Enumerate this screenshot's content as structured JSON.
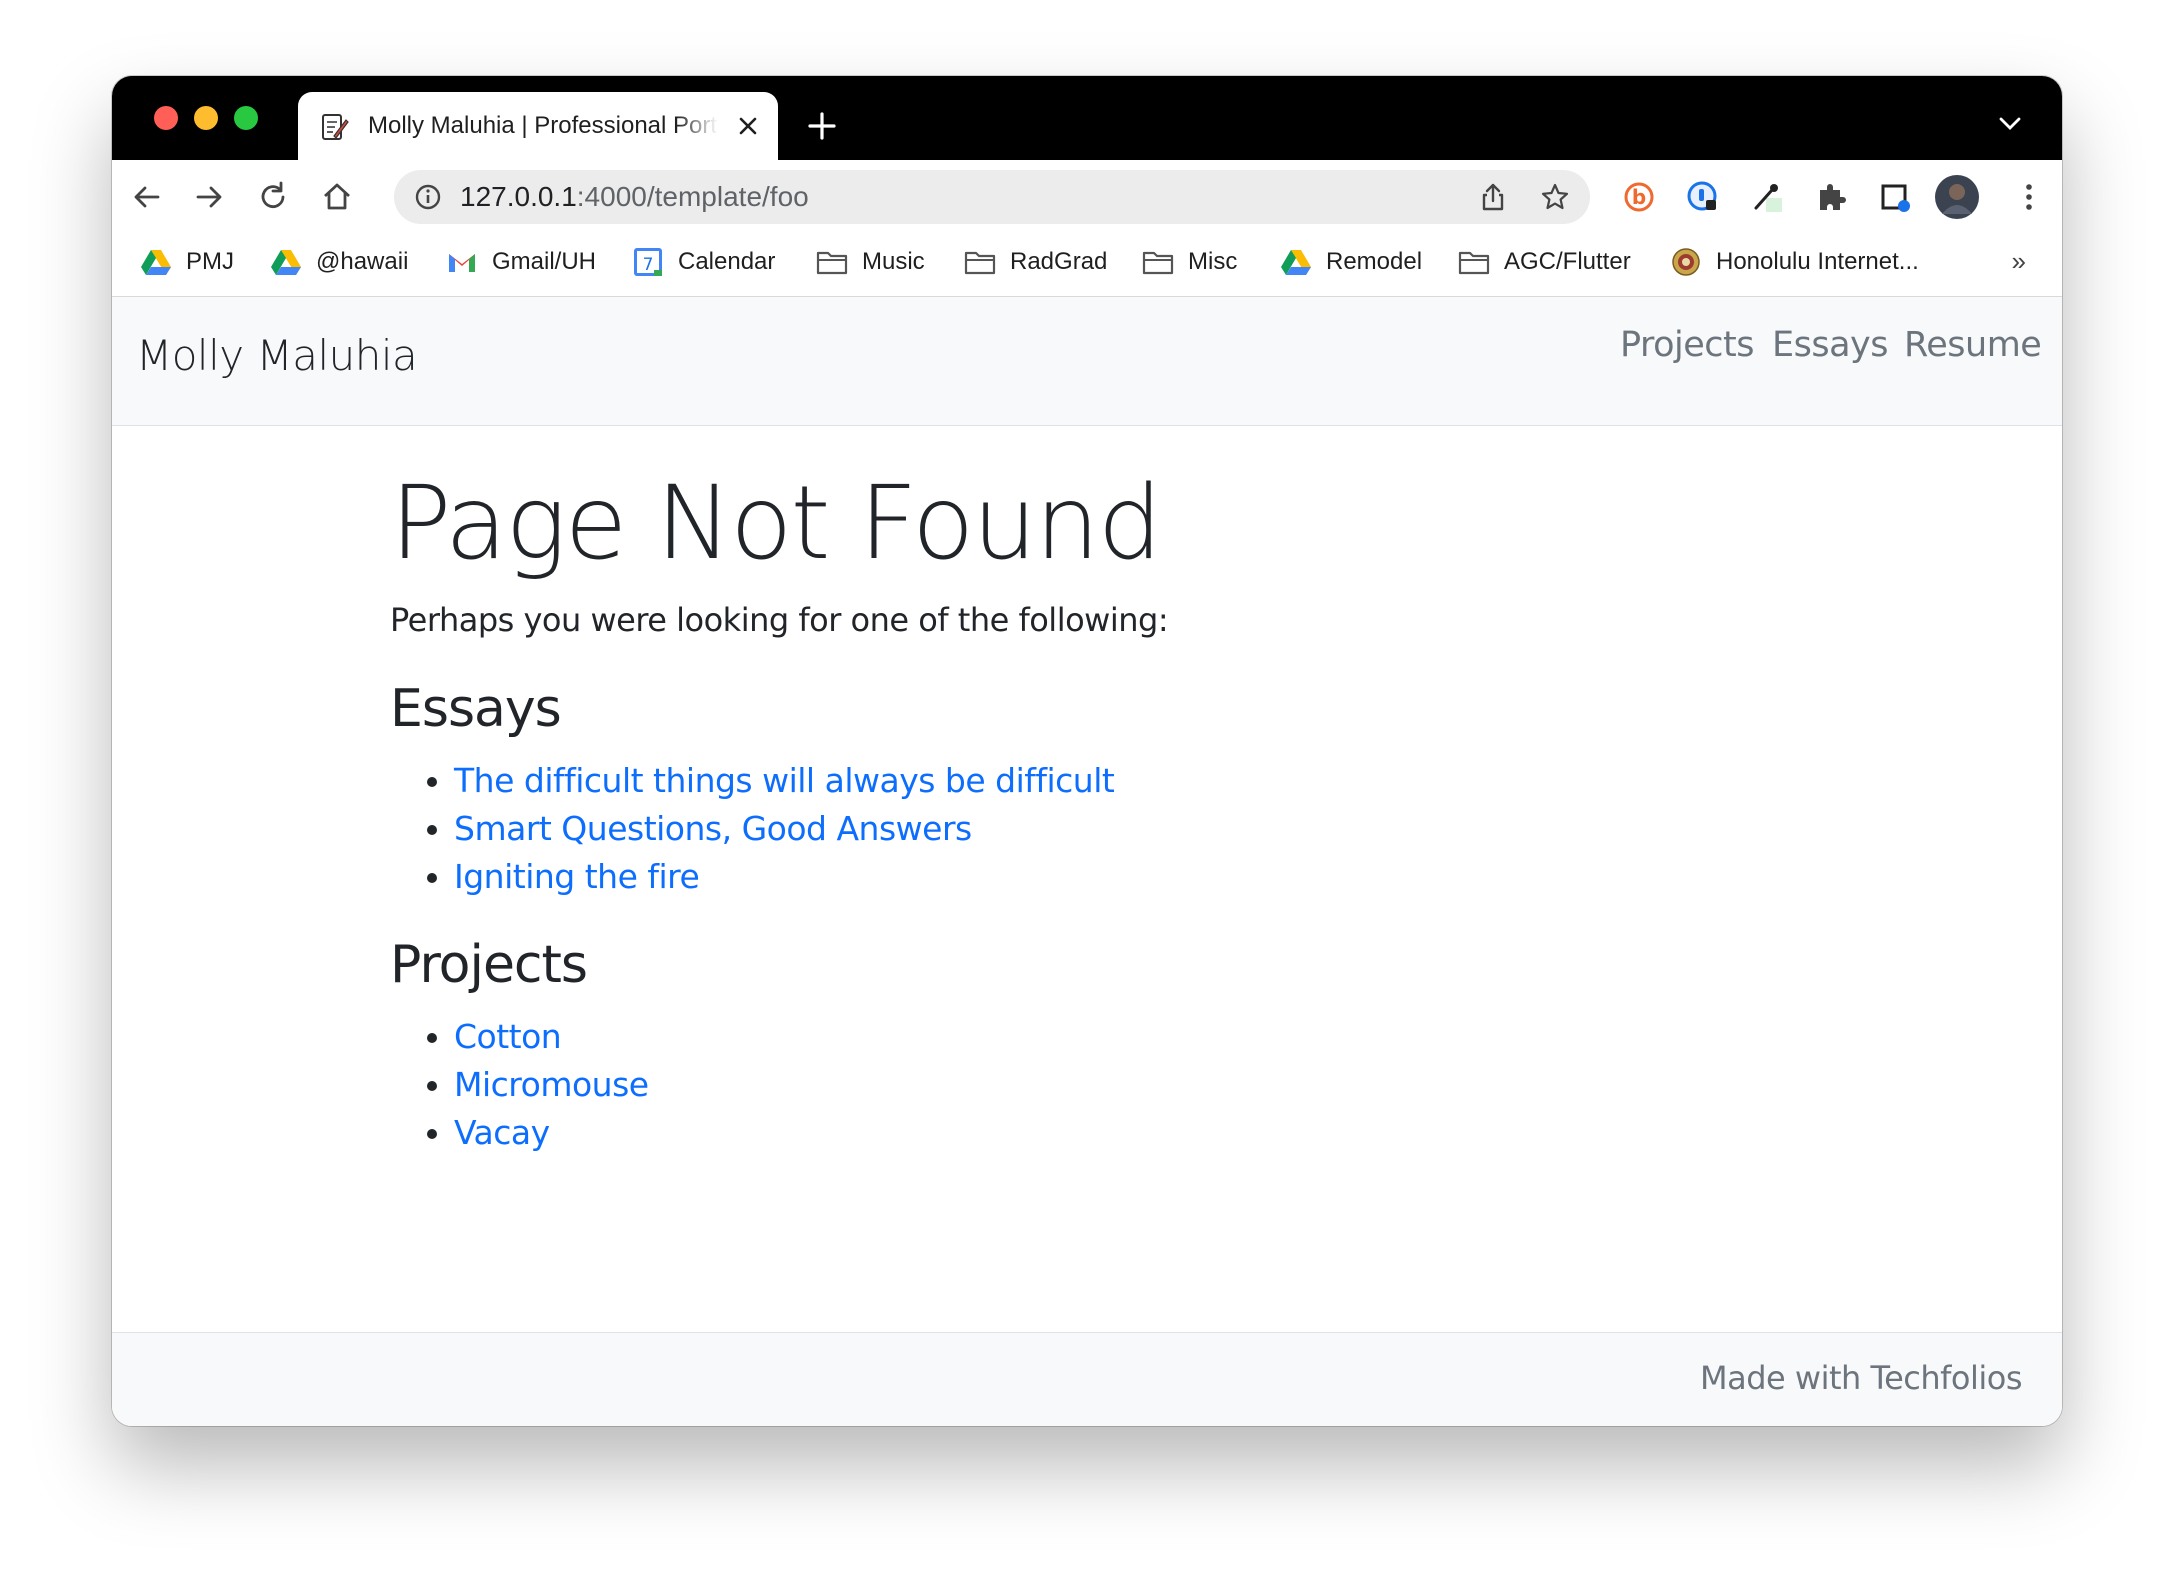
{
  "browser": {
    "tab": {
      "title": "Molly Maluhia | Professional Portfolio",
      "favicon": "document-pencil-icon"
    },
    "address": {
      "host": "127.0.0.1",
      "path": ":4000/template/foo"
    },
    "bookmarks": [
      {
        "label": "PMJ",
        "icon": "google-drive-icon"
      },
      {
        "label": "@hawaii",
        "icon": "google-drive-icon"
      },
      {
        "label": "Gmail/UH",
        "icon": "gmail-icon"
      },
      {
        "label": "Calendar",
        "icon": "google-calendar-icon"
      },
      {
        "label": "Music",
        "icon": "folder-icon"
      },
      {
        "label": "RadGrad",
        "icon": "folder-icon"
      },
      {
        "label": "Misc",
        "icon": "folder-icon"
      },
      {
        "label": "Remodel",
        "icon": "google-drive-icon"
      },
      {
        "label": "AGC/Flutter",
        "icon": "folder-icon"
      },
      {
        "label": "Honolulu Internet...",
        "icon": "seal-icon"
      }
    ],
    "bookmarks_overflow": "»",
    "calendar_day": "7"
  },
  "site": {
    "brand": "Molly Maluhia",
    "nav": [
      "Projects",
      "Essays",
      "Resume"
    ],
    "heading": "Page Not Found",
    "lead": "Perhaps you were looking for one of the following:",
    "essays_heading": "Essays",
    "essays": [
      "The difficult things will always be difficult",
      "Smart Questions, Good Answers",
      "Igniting the fire"
    ],
    "projects_heading": "Projects",
    "projects": [
      "Cotton",
      "Micromouse",
      "Vacay"
    ],
    "footer": "Made with Techfolios"
  },
  "colors": {
    "link": "#0d6efd",
    "navbar_bg": "#f8f9fa",
    "muted_text": "#6c757d",
    "chrome_tabstrip": "#000000"
  }
}
